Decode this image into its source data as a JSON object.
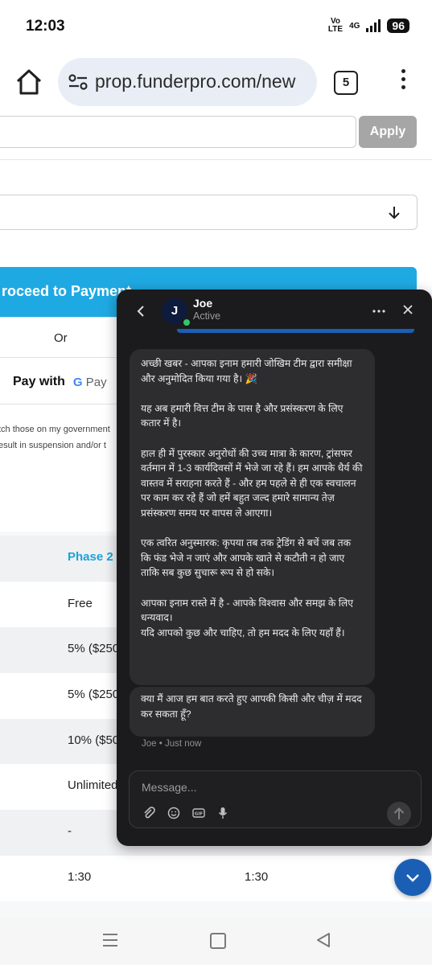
{
  "status_bar": {
    "time": "12:03",
    "volte": "Vo\nLTE",
    "network": "4G",
    "battery": "96"
  },
  "browser": {
    "url": "prop.funderpro.com/new",
    "tab_count": "5"
  },
  "page": {
    "apply_label": "Apply",
    "proceed_label": "roceed to Payment",
    "or_label": "Or",
    "pay_with_label": "Pay with",
    "gpay_g": "G",
    "gpay_label": "Pay",
    "disclaimer_line1": "tch those on my government",
    "disclaimer_line2": "esult in suspension and/or t",
    "table": {
      "header": "Phase 2",
      "rows": [
        {
          "col1": "Free",
          "col2": ""
        },
        {
          "col1": "5% ($250",
          "col2": ""
        },
        {
          "col1": "5% ($250",
          "col2": ""
        },
        {
          "col1": "10% ($50",
          "col2": ""
        },
        {
          "col1": "Unlimited",
          "col2": ""
        },
        {
          "col1": "-",
          "col2": ""
        },
        {
          "col1": "1:30",
          "col2": "1:30"
        }
      ]
    }
  },
  "chat": {
    "agent_initial": "J",
    "agent_name": "Joe",
    "agent_status": "Active",
    "message1": "अच्छी खबर - आपका इनाम हमारी जोखिम टीम द्वारा समीक्षा और अनुमोदित किया गया है। 🎉\n\nयह अब हमारी वित्त टीम के पास है और प्रसंस्करण के लिए कतार में है।\n\nहाल ही में पुरस्कार अनुरोधों की उच्च मात्रा के कारण, ट्रांसफर वर्तमान में 1-3 कार्यदिवसों में भेजे जा रहे हैं। हम आपके धैर्य की वास्तव में सराहना करते हैं - और हम पहले से ही एक स्वचालन पर काम कर रहे हैं जो हमें बहुत जल्द हमारे सामान्य तेज़ प्रसंस्करण समय पर वापस ले आएगा।\n\nएक त्वरित अनुस्मारक: कृपया तब तक ट्रेडिंग से बचें जब तक कि फंड भेजे न जाएं और आपके खाते से कटौती न हो जाए ताकि सब कुछ सुचारू रूप से हो सके।\n\nआपका इनाम रास्ते में है - आपके विश्वास और समझ के लिए धन्यवाद।\nयदि आपको कुछ और चाहिए, तो हम मदद के लिए यहाँ हैं।",
    "message2": "क्या मैं आज हम बात करते हुए आपकी किसी और चीज़ में मदद कर सकता हूँ?",
    "message_meta": "Joe • Just now",
    "composer_placeholder": "Message..."
  }
}
